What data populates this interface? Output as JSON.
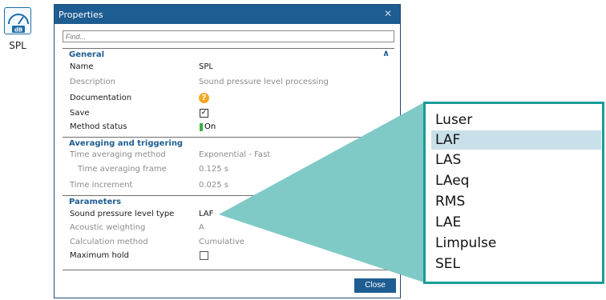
{
  "desktop_icon": {
    "label": "SPL",
    "glyph": "dB"
  },
  "window": {
    "title": "Properties",
    "close_glyph": "✕",
    "search": {
      "placeholder": "Find..."
    },
    "sections": {
      "general": {
        "title": "General",
        "rows": {
          "name": {
            "label": "Name",
            "value": "SPL"
          },
          "description": {
            "label": "Description",
            "value": "Sound pressure level processing"
          },
          "documentation": {
            "label": "Documentation",
            "icon": "?"
          },
          "save": {
            "label": "Save",
            "checked": true,
            "mark": "✓"
          },
          "method_status": {
            "label": "Method status",
            "value": "On"
          }
        }
      },
      "averaging": {
        "title": "Averaging and triggering",
        "rows": {
          "time_averaging_method": {
            "label": "Time averaging method",
            "value": "Exponential - Fast"
          },
          "time_averaging_frame": {
            "label": "Time averaging frame",
            "value": "0.125  s"
          },
          "time_increment": {
            "label": "Time increment",
            "value": "0.025  s"
          }
        }
      },
      "parameters": {
        "title": "Parameters",
        "rows": {
          "spl_type": {
            "label": "Sound pressure level type",
            "value": "LAF"
          },
          "acoustic_weighting": {
            "label": "Acoustic weighting",
            "value": "A"
          },
          "calculation_method": {
            "label": "Calculation method",
            "value": "Cumulative"
          },
          "maximum_hold": {
            "label": "Maximum hold",
            "checked": false
          }
        }
      }
    },
    "close_button": "Close"
  },
  "dropdown": {
    "options": [
      "Luser",
      "LAF",
      "LAS",
      "LAeq",
      "RMS",
      "LAE",
      "Limpulse",
      "SEL"
    ],
    "selected": "LAF"
  },
  "colors": {
    "titlebar": "#1e5d92",
    "accent": "#1e5d92",
    "callout": "#1a9c98",
    "callout_fill": "#7fcac7",
    "selected_option": "#c8e0ea",
    "status_on": "#3cb043",
    "doc_icon": "#f5a623"
  }
}
